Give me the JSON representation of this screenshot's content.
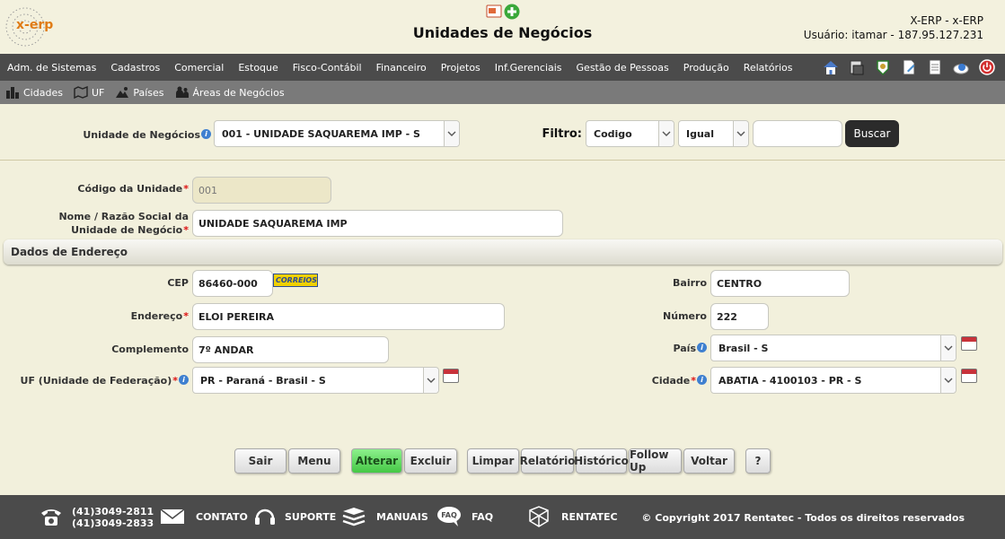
{
  "header": {
    "title": "Unidades de Negócios",
    "logo_text": "x-erp",
    "system": "X-ERP - x-ERP",
    "user": "Usuário: itamar - 187.95.127.231"
  },
  "nav": {
    "items": [
      "Adm. de Sistemas",
      "Cadastros",
      "Comercial",
      "Estoque",
      "Fisco-Contábil",
      "Financeiro",
      "Projetos",
      "Inf.Gerenciais",
      "Gestão de Pessoas",
      "Produção",
      "Relatórios"
    ],
    "icons": [
      "home-icon",
      "printer-icon",
      "badge-icon",
      "document-edit-icon",
      "notepad-icon",
      "cloud-user-icon",
      "power-icon"
    ]
  },
  "subnav": {
    "items": [
      "Cidades",
      "UF",
      "Países",
      "Áreas de Negócios"
    ]
  },
  "selector": {
    "label": "Unidade de Negócios",
    "value": "001 - UNIDADE SAQUAREMA IMP - S",
    "filter_label": "Filtro:",
    "filter_field": "Codigo",
    "filter_op": "Igual",
    "filter_value": "",
    "search_button": "Buscar"
  },
  "form": {
    "codigo_label": "Código da Unidade",
    "codigo_value": "001",
    "nome_label": "Nome / Razão Social da Unidade de Negócio",
    "nome_value": "UNIDADE SAQUAREMA IMP",
    "section_title": "Dados de Endereço",
    "cep_label": "CEP",
    "cep_value": "86460-000",
    "correios_text": "CORREIOS",
    "endereco_label": "Endereço",
    "endereco_value": "ELOI PEREIRA",
    "complemento_label": "Complemento",
    "complemento_value": "7º ANDAR",
    "uf_label": "UF (Unidade de Federação)",
    "uf_value": "PR - Paraná - Brasil - S",
    "bairro_label": "Bairro",
    "bairro_value": "CENTRO",
    "numero_label": "Número",
    "numero_value": "222",
    "pais_label": "País",
    "pais_value": "Brasil - S",
    "cidade_label": "Cidade",
    "cidade_value": "ABATIA - 4100103 - PR - S"
  },
  "buttons": {
    "sair": "Sair",
    "menu": "Menu",
    "alterar": "Alterar",
    "excluir": "Excluir",
    "limpar": "Limpar",
    "relatorio": "Relatório",
    "historico": "Histórico",
    "followup": "Follow Up",
    "voltar": "Voltar",
    "help": "?"
  },
  "footer": {
    "phone1": "(41)3049-2811",
    "phone2": "(41)3049-2833",
    "contato": "CONTATO",
    "suporte": "SUPORTE",
    "manuais": "MANUAIS",
    "faq": "FAQ",
    "faq_icon_text": "FAQ",
    "rentatec": "RENTATEC",
    "copyright": "© Copyright 2017 Rentatec - Todos os direitos reservados"
  },
  "colors": {
    "background": "#f2f0dc",
    "navbar": "#4b4b4b",
    "subnav": "#7a7a7a",
    "accent_green": "#45c845",
    "required": "#d11111",
    "logo_orange": "#e07c16"
  }
}
